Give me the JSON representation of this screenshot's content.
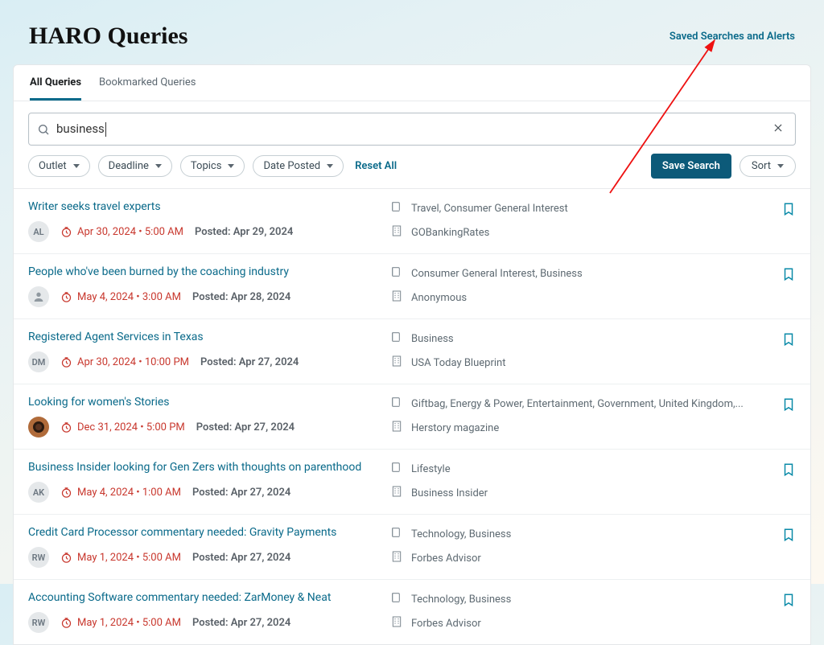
{
  "header": {
    "title": "HARO Queries",
    "saved_searches_label": "Saved Searches and Alerts"
  },
  "tabs": {
    "all": "All Queries",
    "bookmarked": "Bookmarked Queries"
  },
  "search": {
    "value": "business",
    "clear_label": "✕"
  },
  "filters": {
    "outlet": "Outlet",
    "deadline": "Deadline",
    "topics": "Topics",
    "date_posted": "Date Posted",
    "reset": "Reset All",
    "save_search": "Save Search",
    "sort": "Sort"
  },
  "rows": [
    {
      "title": "Writer seeks travel experts",
      "avatar": "AL",
      "deadline": "Apr 30, 2024  •  5:00 AM",
      "posted": "Posted: Apr 29, 2024",
      "topics": "Travel, Consumer General Interest",
      "outlet": "GOBankingRates"
    },
    {
      "title": "People who've been burned by the coaching industry",
      "avatar": "",
      "deadline": "May 4, 2024  •  3:00 AM",
      "posted": "Posted: Apr 28, 2024",
      "topics": "Consumer General Interest, Business",
      "outlet": "Anonymous"
    },
    {
      "title": "Registered Agent Services in Texas",
      "avatar": "DM",
      "deadline": "Apr 30, 2024  •  10:00 PM",
      "posted": "Posted: Apr 27, 2024",
      "topics": "Business",
      "outlet": "USA Today Blueprint"
    },
    {
      "title": "Looking for women's Stories",
      "avatar": "photo",
      "deadline": "Dec 31, 2024  •  5:00 PM",
      "posted": "Posted: Apr 27, 2024",
      "topics": "Giftbag, Energy & Power, Entertainment, Government, United Kingdom,...",
      "outlet": "Herstory magazine"
    },
    {
      "title": "Business Insider looking for Gen Zers with thoughts on parenthood",
      "avatar": "AK",
      "deadline": "May 4, 2024  •  1:00 AM",
      "posted": "Posted: Apr 27, 2024",
      "topics": "Lifestyle",
      "outlet": "Business Insider"
    },
    {
      "title": "Credit Card Processor commentary needed: Gravity Payments",
      "avatar": "RW",
      "deadline": "May 1, 2024  •  5:00 AM",
      "posted": "Posted: Apr 27, 2024",
      "topics": "Technology, Business",
      "outlet": "Forbes Advisor"
    },
    {
      "title": "Accounting Software commentary needed: ZarMoney & Neat",
      "avatar": "RW",
      "deadline": "May 1, 2024  •  5:00 AM",
      "posted": "Posted: Apr 27, 2024",
      "topics": "Technology, Business",
      "outlet": "Forbes Advisor"
    }
  ]
}
